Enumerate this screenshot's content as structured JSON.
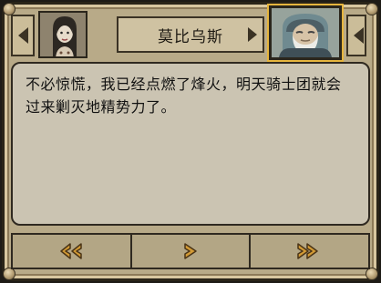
{
  "header": {
    "speaker_name": "莫比乌斯"
  },
  "dialog": {
    "text": "不必惊慌，我已经点燃了烽火，明天骑士团就会过来剿灭地精势力了。"
  },
  "controls": {
    "buttons": [
      {
        "icon": "double-left-arrow-icon"
      },
      {
        "icon": "play-arrow-icon"
      },
      {
        "icon": "fast-forward-icon"
      }
    ]
  },
  "colors": {
    "frame": "#b8aa88",
    "panel": "#cbc4b2",
    "highlight": "#e6b53e",
    "arrow": "#c9922c"
  }
}
